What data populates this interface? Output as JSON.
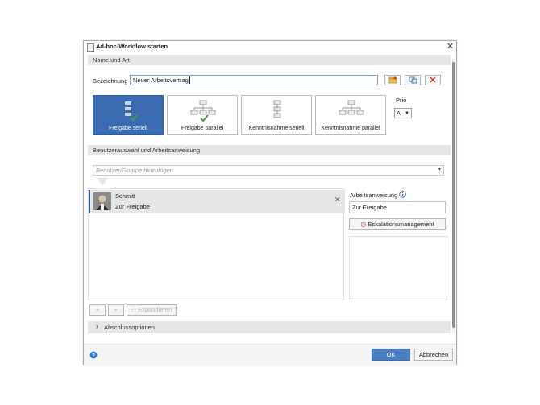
{
  "window": {
    "title": "Ad-hoc-Workflow starten"
  },
  "name_section": {
    "header": "Name und Art",
    "name_label": "Bezeichnung",
    "name_value": "Neuer Arbeitsvertrag",
    "prio_label": "Prio",
    "prio_value": "A"
  },
  "workflow_types": [
    {
      "label": "Freigabe seriell",
      "selected": true
    },
    {
      "label": "Freigabe parallel",
      "selected": false
    },
    {
      "label": "Kenntnisnahme seriell",
      "selected": false
    },
    {
      "label": "Kenntnisnahme parallel",
      "selected": false
    }
  ],
  "users_section": {
    "header": "Benutzerauswahl und Arbeitsanweisung",
    "add_placeholder": "Benutzer/Gruppe hinzufügen",
    "user_name": "Schmitt",
    "user_task": "Zur Freigabe",
    "instruction_label": "Arbeitsanweisung",
    "instruction_value": "Zur Freigabe",
    "escalation_label": "Eskalationsmanagement",
    "expand_label": "Expandieren",
    "add_symbol": "+"
  },
  "completion_section": {
    "header": "Abschlussoptionen"
  },
  "footer": {
    "ok_label": "OK",
    "cancel_label": "Abbrechen"
  },
  "colors": {
    "accent": "#3b6bb1",
    "primary_button": "#4a7fc1",
    "section_bg": "#e6e6e6",
    "check_green": "#3aa33a",
    "delete_red": "#c0392b"
  }
}
